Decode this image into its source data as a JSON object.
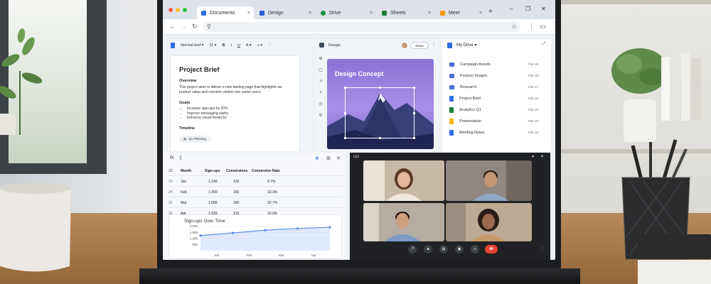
{
  "browser": {
    "tabs": [
      {
        "label": "Documents",
        "color": "#2f6fe4",
        "active": true
      },
      {
        "label": "Design",
        "color": "#2b5fd6",
        "active": false
      },
      {
        "label": "Drive",
        "color": "#1e8e3e",
        "active": false
      },
      {
        "label": "Sheets",
        "color": "#188038",
        "active": false
      },
      {
        "label": "Meet",
        "color": "#f29900",
        "active": false
      }
    ],
    "new_tab": "+",
    "close_glyph": "×",
    "window_controls": [
      "–",
      "❐",
      "✕"
    ],
    "nav": {
      "back": "←",
      "forward": "→",
      "reload": "↻"
    },
    "omnibox_icon": "search-icon",
    "toolbar_right": [
      "⋮",
      "▭"
    ]
  },
  "docs": {
    "toolbar": [
      "Normal text ▾",
      "11 ▾",
      "B",
      "I",
      "U",
      "A ▾",
      "≡ ▾",
      "⋮"
    ],
    "title": "Project Brief",
    "overview_heading": "Overview",
    "overview_text": "This project aims to deliver a new landing page that highlights our product value and converts visitors into active users.",
    "goals_heading": "Goals",
    "goals": [
      "Increase sign-ups by 20%",
      "Improve messaging clarity",
      "Enhance visual hierarchy"
    ],
    "timeline_heading": "Timeline",
    "timeline_chip": "Q1 Planning"
  },
  "design": {
    "app_label": "Design",
    "share_label": "Share",
    "more": "⋮",
    "tools": [
      "⊕",
      "▢",
      "↗",
      "⌕",
      "◷",
      "⚲"
    ],
    "canvas_title": "Design Concept"
  },
  "drive": {
    "title": "My Drive ▾",
    "expand": "⤢",
    "files": [
      {
        "name": "Campaign Assets",
        "date": "Feb 18",
        "kind": "folder",
        "color": "#4a6fd8"
      },
      {
        "name": "Product Images",
        "date": "Feb 18",
        "kind": "folder",
        "color": "#4a6fd8"
      },
      {
        "name": "Research",
        "date": "Feb 17",
        "kind": "folder",
        "color": "#4a6fd8"
      },
      {
        "name": "Project Brief",
        "date": "Feb 16",
        "kind": "doc",
        "color": "#2f6fe4"
      },
      {
        "name": "Analytics Q1",
        "date": "Feb 16",
        "kind": "sheet",
        "color": "#188038"
      },
      {
        "name": "Presentation",
        "date": "Feb 15",
        "kind": "slides",
        "color": "#f4b400"
      },
      {
        "name": "Meeting Notes",
        "date": "Feb 16",
        "kind": "doc",
        "color": "#2f6fe4"
      }
    ]
  },
  "sheets": {
    "fx_label": "fx",
    "formula": "(",
    "icons": [
      "⊕",
      "⊞",
      "✕"
    ],
    "headers": [
      "Month",
      "Sign-ups",
      "Conversions",
      "Conversion Rate"
    ],
    "rows": [
      {
        "idx": "23",
        "cells": [
          "Jan",
          "1,240",
          "120",
          "9.7%"
        ]
      },
      {
        "idx": "24",
        "cells": [
          "Feb",
          "1,450",
          "150",
          "10.3%"
        ]
      },
      {
        "idx": "25",
        "cells": [
          "Mar",
          "1,680",
          "180",
          "10.7%"
        ]
      },
      {
        "idx": "26",
        "cells": [
          "Apr",
          "1,920",
          "210",
          "10.9%"
        ]
      }
    ],
    "header_idx": "23"
  },
  "chart_data": {
    "type": "line",
    "title": "Sign-ups Over Time",
    "categories": [
      "Jan",
      "Feb",
      "Mar",
      "Apr"
    ],
    "x_points": [
      0,
      1,
      2,
      3,
      4
    ],
    "values": [
      1240,
      1450,
      1680,
      1820,
      1920
    ],
    "yticks": [
      "2,000",
      "1,500",
      "1,000",
      "500"
    ],
    "ylim": [
      0,
      2100
    ],
    "color": "#5b8def",
    "area": true
  },
  "meet": {
    "pin_label": "⊡⊡",
    "top_icons": [
      "▾",
      "✕"
    ],
    "participants": [
      {
        "name": "participant-1",
        "bg": "#b8a48e"
      },
      {
        "name": "participant-2",
        "bg": "#9a8f86"
      },
      {
        "name": "participant-3",
        "bg": "#a69c92"
      },
      {
        "name": "participant-4",
        "bg": "#b39f8b"
      }
    ],
    "controls": [
      "mic-icon",
      "camera-icon",
      "captions-icon",
      "present-icon",
      "screen-icon",
      "end-call-icon"
    ],
    "more": "⋮"
  }
}
